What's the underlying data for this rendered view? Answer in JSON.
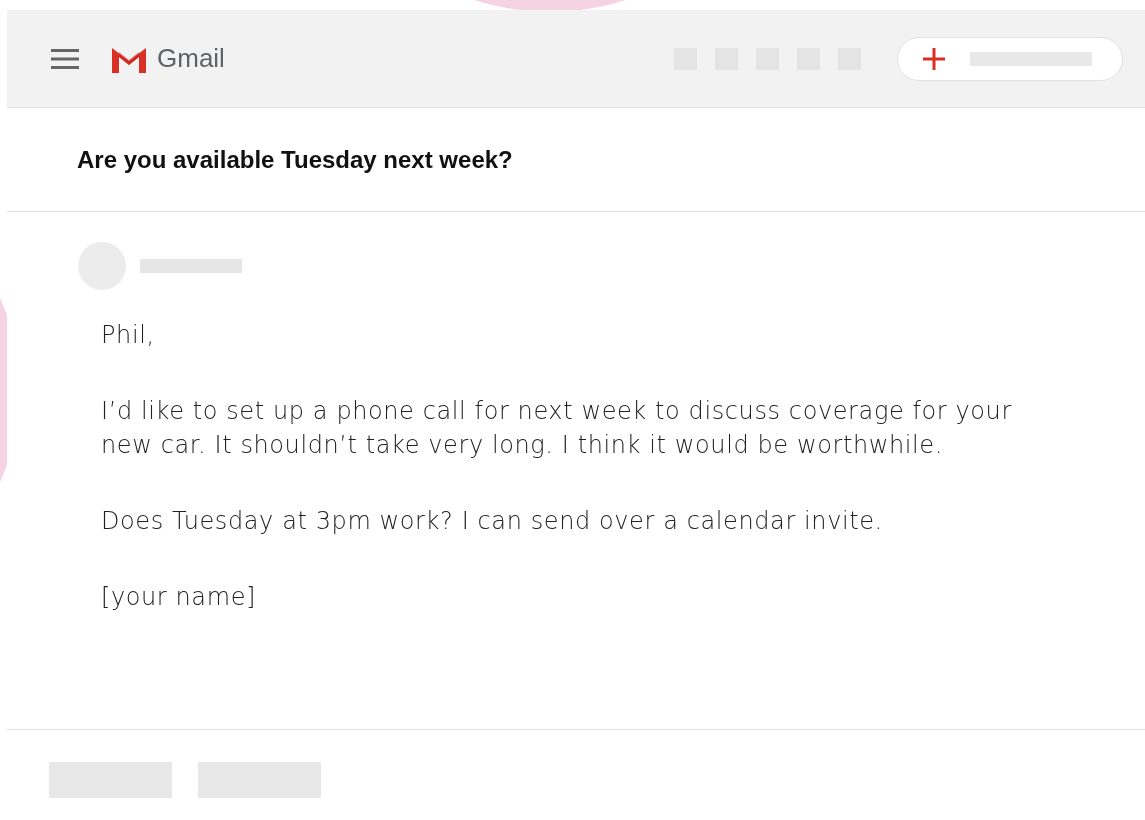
{
  "header": {
    "app_name": "Gmail"
  },
  "subject": "Are you available Tuesday next week?",
  "message": {
    "paragraphs": [
      "Phil,",
      "I’d like to set up a phone call for next week to discuss coverage for your new car. It shouldn’t take very long. I think it would be worthwhile.",
      "Does Tuesday at 3pm work? I can send over a calendar invite.",
      "[your name]"
    ]
  }
}
